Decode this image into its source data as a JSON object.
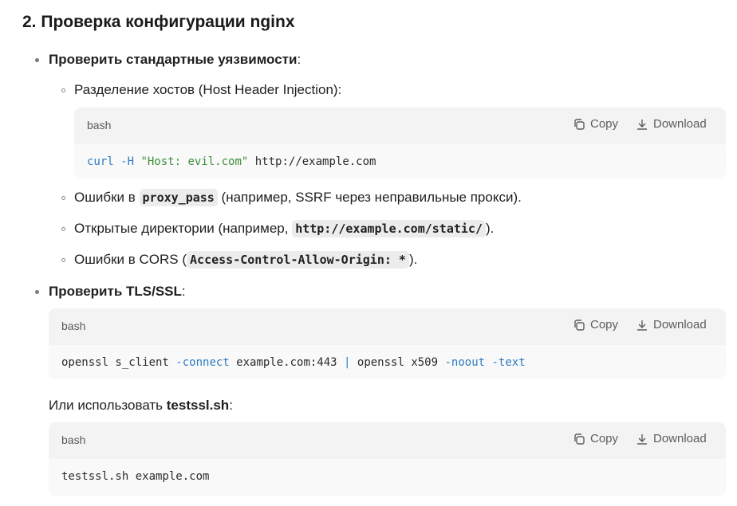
{
  "section": {
    "title": "2. Проверка конфигурации nginx"
  },
  "item1": {
    "label": "Проверить стандартные уязвимости",
    "colon": ":",
    "sub": {
      "hosts": "Разделение хостов (Host Header Injection):",
      "proxy_pre": "Ошибки в ",
      "proxy_code": "proxy_pass",
      "proxy_post": " (например, SSRF через неправильные прокси).",
      "dirs_pre": "Открытые директории (например, ",
      "dirs_code": "http://example.com/static/",
      "dirs_post": ").",
      "cors_pre": "Ошибки в CORS (",
      "cors_code": "Access-Control-Allow-Origin: *",
      "cors_post": ")."
    },
    "code": {
      "lang": "bash",
      "copy": "Copy",
      "download": "Download",
      "t1": "curl",
      "t2": " -H",
      "t3": " \"Host: evil.com\"",
      "t4": " http://example.com"
    }
  },
  "item2": {
    "label": "Проверить TLS/SSL",
    "colon": ":",
    "code": {
      "lang": "bash",
      "copy": "Copy",
      "download": "Download",
      "t1": "openssl s_client ",
      "t2": "-connect",
      "t3": " example.com:443 ",
      "t4": "|",
      "t5": " openssl x509 ",
      "t6": "-noout",
      "t7": " ",
      "t8": "-text"
    },
    "alt_pre": "Или использовать ",
    "alt_bold": "testssl.sh",
    "alt_post": ":",
    "code2": {
      "lang": "bash",
      "copy": "Copy",
      "download": "Download",
      "line": "testssl.sh example.com"
    }
  },
  "icons": [
    "copy-icon",
    "download-icon"
  ],
  "colors": {
    "code_header_bg": "#f3f3f3",
    "code_body_bg": "#f9f9f9",
    "syntax_blue": "#2d7cc2",
    "syntax_green": "#3c8f3c"
  }
}
